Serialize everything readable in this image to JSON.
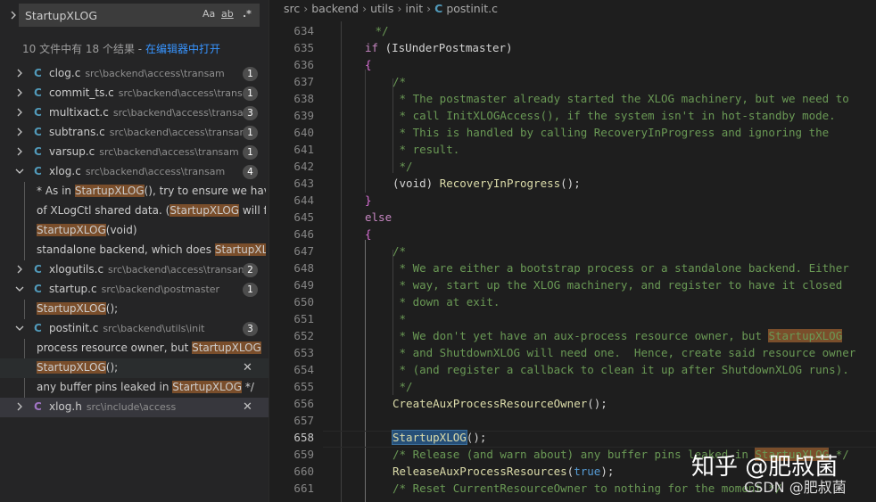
{
  "search": {
    "query": "StartupXLOG",
    "opt_case": "Aa",
    "opt_word": "ab",
    "opt_regex": ".*",
    "summary_text": "10 文件中有 18 个结果 - ",
    "open_in_editor": "在编辑器中打开"
  },
  "results": {
    "clog": {
      "name": "clog.c",
      "path": "src\\backend\\access\\transam",
      "count": "1"
    },
    "commit_ts": {
      "name": "commit_ts.c",
      "path": "src\\backend\\access\\trans...",
      "count": "1"
    },
    "multixact": {
      "name": "multixact.c",
      "path": "src\\backend\\access\\transam",
      "count": "3"
    },
    "subtrans": {
      "name": "subtrans.c",
      "path": "src\\backend\\access\\transam",
      "count": "1"
    },
    "varsup": {
      "name": "varsup.c",
      "path": "src\\backend\\access\\transam",
      "count": "1"
    },
    "xlog": {
      "name": "xlog.c",
      "path": "src\\backend\\access\\transam",
      "count": "4",
      "m1a": "* As in ",
      "m1b": "StartupXLOG",
      "m1c": "(), try to ensure we hav...",
      "m2a": "of XLogCtl shared data. (",
      "m2b": "StartupXLOG",
      "m2c": " will fill",
      "m3b": "StartupXLOG",
      "m3c": "(void)",
      "m4a": "standalone backend, which does ",
      "m4b": "StartupXL..."
    },
    "xlogutils": {
      "name": "xlogutils.c",
      "path": "src\\backend\\access\\transam",
      "count": "2"
    },
    "startup": {
      "name": "startup.c",
      "path": "src\\backend\\postmaster",
      "count": "1",
      "m1b": "StartupXLOG",
      "m1c": "();"
    },
    "postinit": {
      "name": "postinit.c",
      "path": "src\\backend\\utils\\init",
      "count": "3",
      "m1a": "process resource owner, but ",
      "m1b": "StartupXLOG",
      "m2b": "StartupXLOG",
      "m2c": "();",
      "m3a": "any buffer pins leaked in ",
      "m3b": "StartupXLOG",
      "m3c": " */"
    },
    "xlogh": {
      "name": "xlog.h",
      "path": "src\\include\\access"
    }
  },
  "file_icon_c": "C",
  "close_glyph": "✕",
  "breadcrumb": {
    "p1": "src",
    "p2": "backend",
    "p3": "utils",
    "p4": "init",
    "p5": "postinit.c"
  },
  "lines": [
    "634",
    "635",
    "636",
    "637",
    "638",
    "639",
    "640",
    "641",
    "642",
    "643",
    "644",
    "645",
    "646",
    "647",
    "648",
    "649",
    "650",
    "651",
    "652",
    "653",
    "654",
    "655",
    "656",
    "657",
    "658",
    "659",
    "660",
    "661"
  ],
  "code": {
    "l634": " */",
    "l635_kw": "if",
    "l635_rest": " (IsUnderPostmaster)",
    "l636": "{",
    "l637": "/*",
    "l638": " * The postmaster already started the XLOG machinery, but we need to",
    "l639": " * call InitXLOGAccess(), if the system isn't in hot-standby mode.",
    "l640": " * This is handled by calling RecoveryInProgress and ignoring the",
    "l641": " * result.",
    "l642": " */",
    "l643_a": "(void) ",
    "l643_fn": "RecoveryInProgress",
    "l643_b": "();",
    "l644": "}",
    "l645": "else",
    "l646": "{",
    "l647": "/*",
    "l648": " * We are either a bootstrap process or a standalone backend. Either",
    "l649": " * way, start up the XLOG machinery, and register to have it closed",
    "l650": " * down at exit.",
    "l651": " *",
    "l652_a": " * We don't yet have an aux-process resource owner, but ",
    "l652_hl": "StartupXLOG",
    "l653": " * and ShutdownXLOG will need one.  Hence, create said resource owner",
    "l654": " * (and register a callback to clean it up after ShutdownXLOG runs).",
    "l655": " */",
    "l656_fn": "CreateAuxProcessResourceOwner",
    "l656_b": "();",
    "l658_fn": "StartupXLOG",
    "l658_b": "();",
    "l659_a": "/* Release (and warn about) any buffer pins leaked in ",
    "l659_hl": "StartupXLOG",
    "l659_c": " */",
    "l660_fn": "ReleaseAuxProcessResources",
    "l660_p": "(",
    "l660_t": "true",
    "l660_e": ");",
    "l661": "/* Reset CurrentResourceOwner to nothing for the moment */"
  },
  "watermark": {
    "big": "知乎 @肥叔菌",
    "small": "CSDN @肥叔菌"
  },
  "colors": {
    "match_highlight": "#7a4e2b",
    "c_icon": "#519aba",
    "h_icon": "#a074c4",
    "link": "#3794ff"
  }
}
